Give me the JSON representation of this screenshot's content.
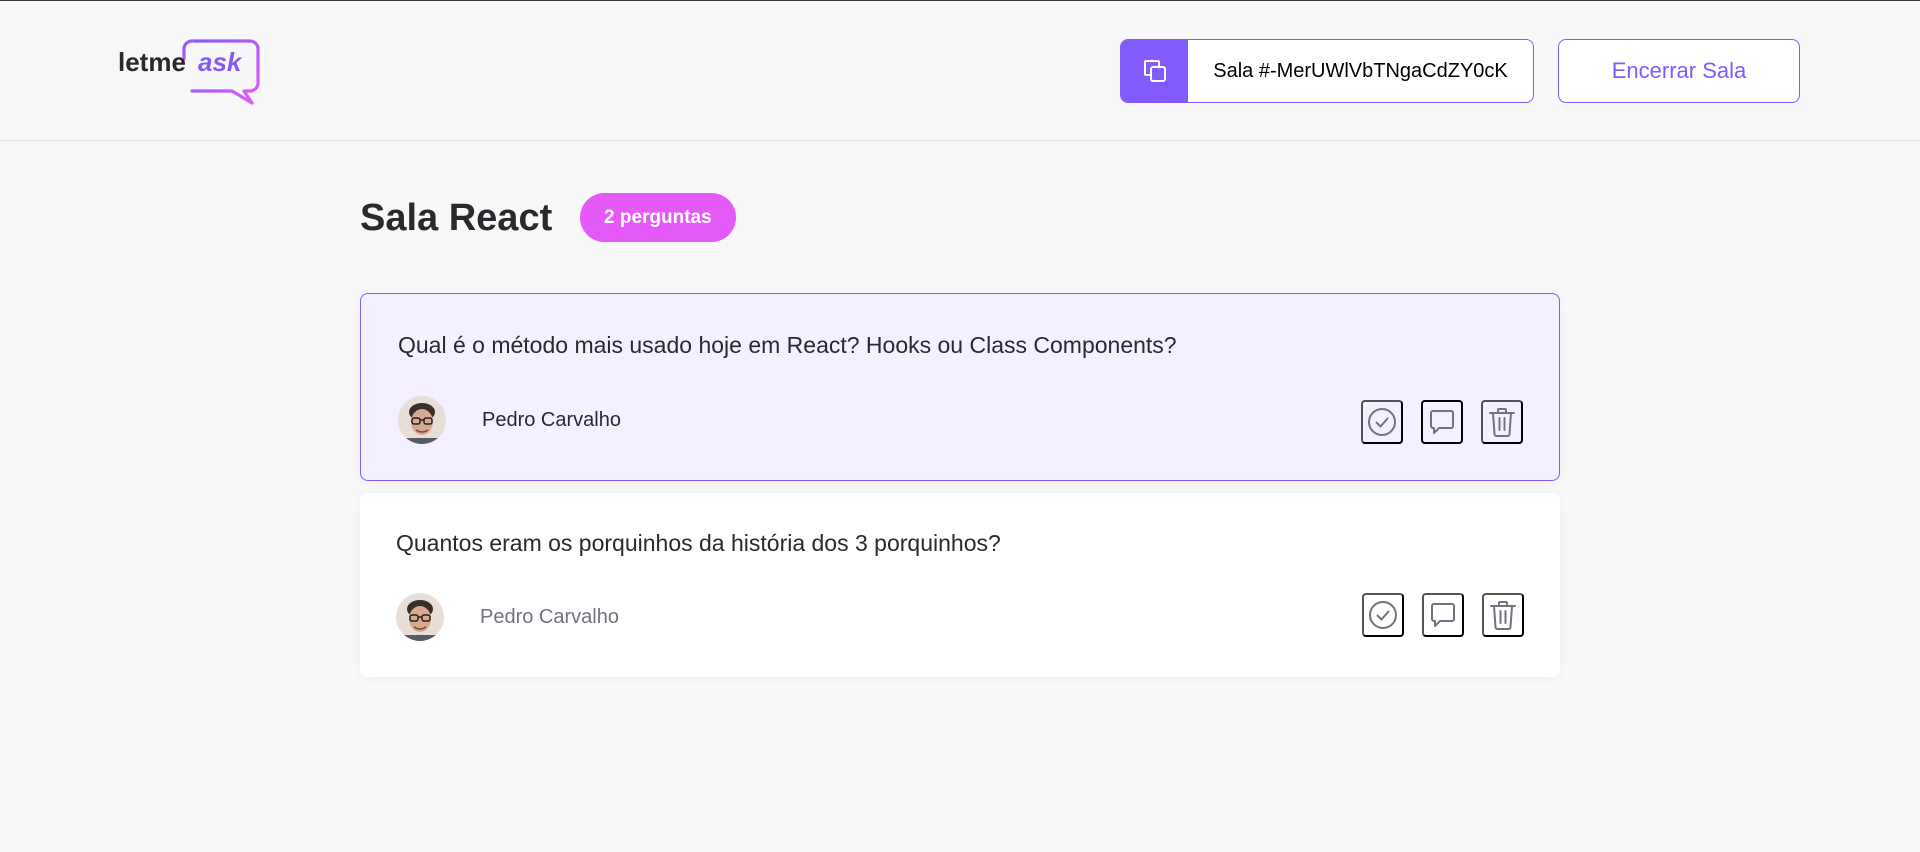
{
  "app": {
    "logo_text_prefix": "letme",
    "logo_text_accent": "ask"
  },
  "header": {
    "room_code_text": "Sala #-MerUWlVbTNgaCdZY0cK",
    "end_room_label": "Encerrar Sala"
  },
  "room": {
    "title": "Sala React",
    "question_count_label": "2 perguntas"
  },
  "questions": [
    {
      "content": "Qual é o método mais usado hoje em React? Hooks ou Class Components?",
      "author": "Pedro Carvalho",
      "highlighted": true,
      "actions": [
        "check-circle-icon",
        "answer-balloon-icon",
        "delete-trash-icon"
      ]
    },
    {
      "content": "Quantos eram os porquinhos da história dos 3 porquinhos?",
      "author": "Pedro Carvalho",
      "highlighted": false,
      "actions": [
        "check-circle-icon",
        "answer-balloon-icon",
        "delete-trash-icon"
      ]
    }
  ],
  "colors": {
    "brand": "#835afd",
    "badge": "#e559f9",
    "highlight_bg": "#f4f0ff",
    "icon_gray": "#737380"
  }
}
